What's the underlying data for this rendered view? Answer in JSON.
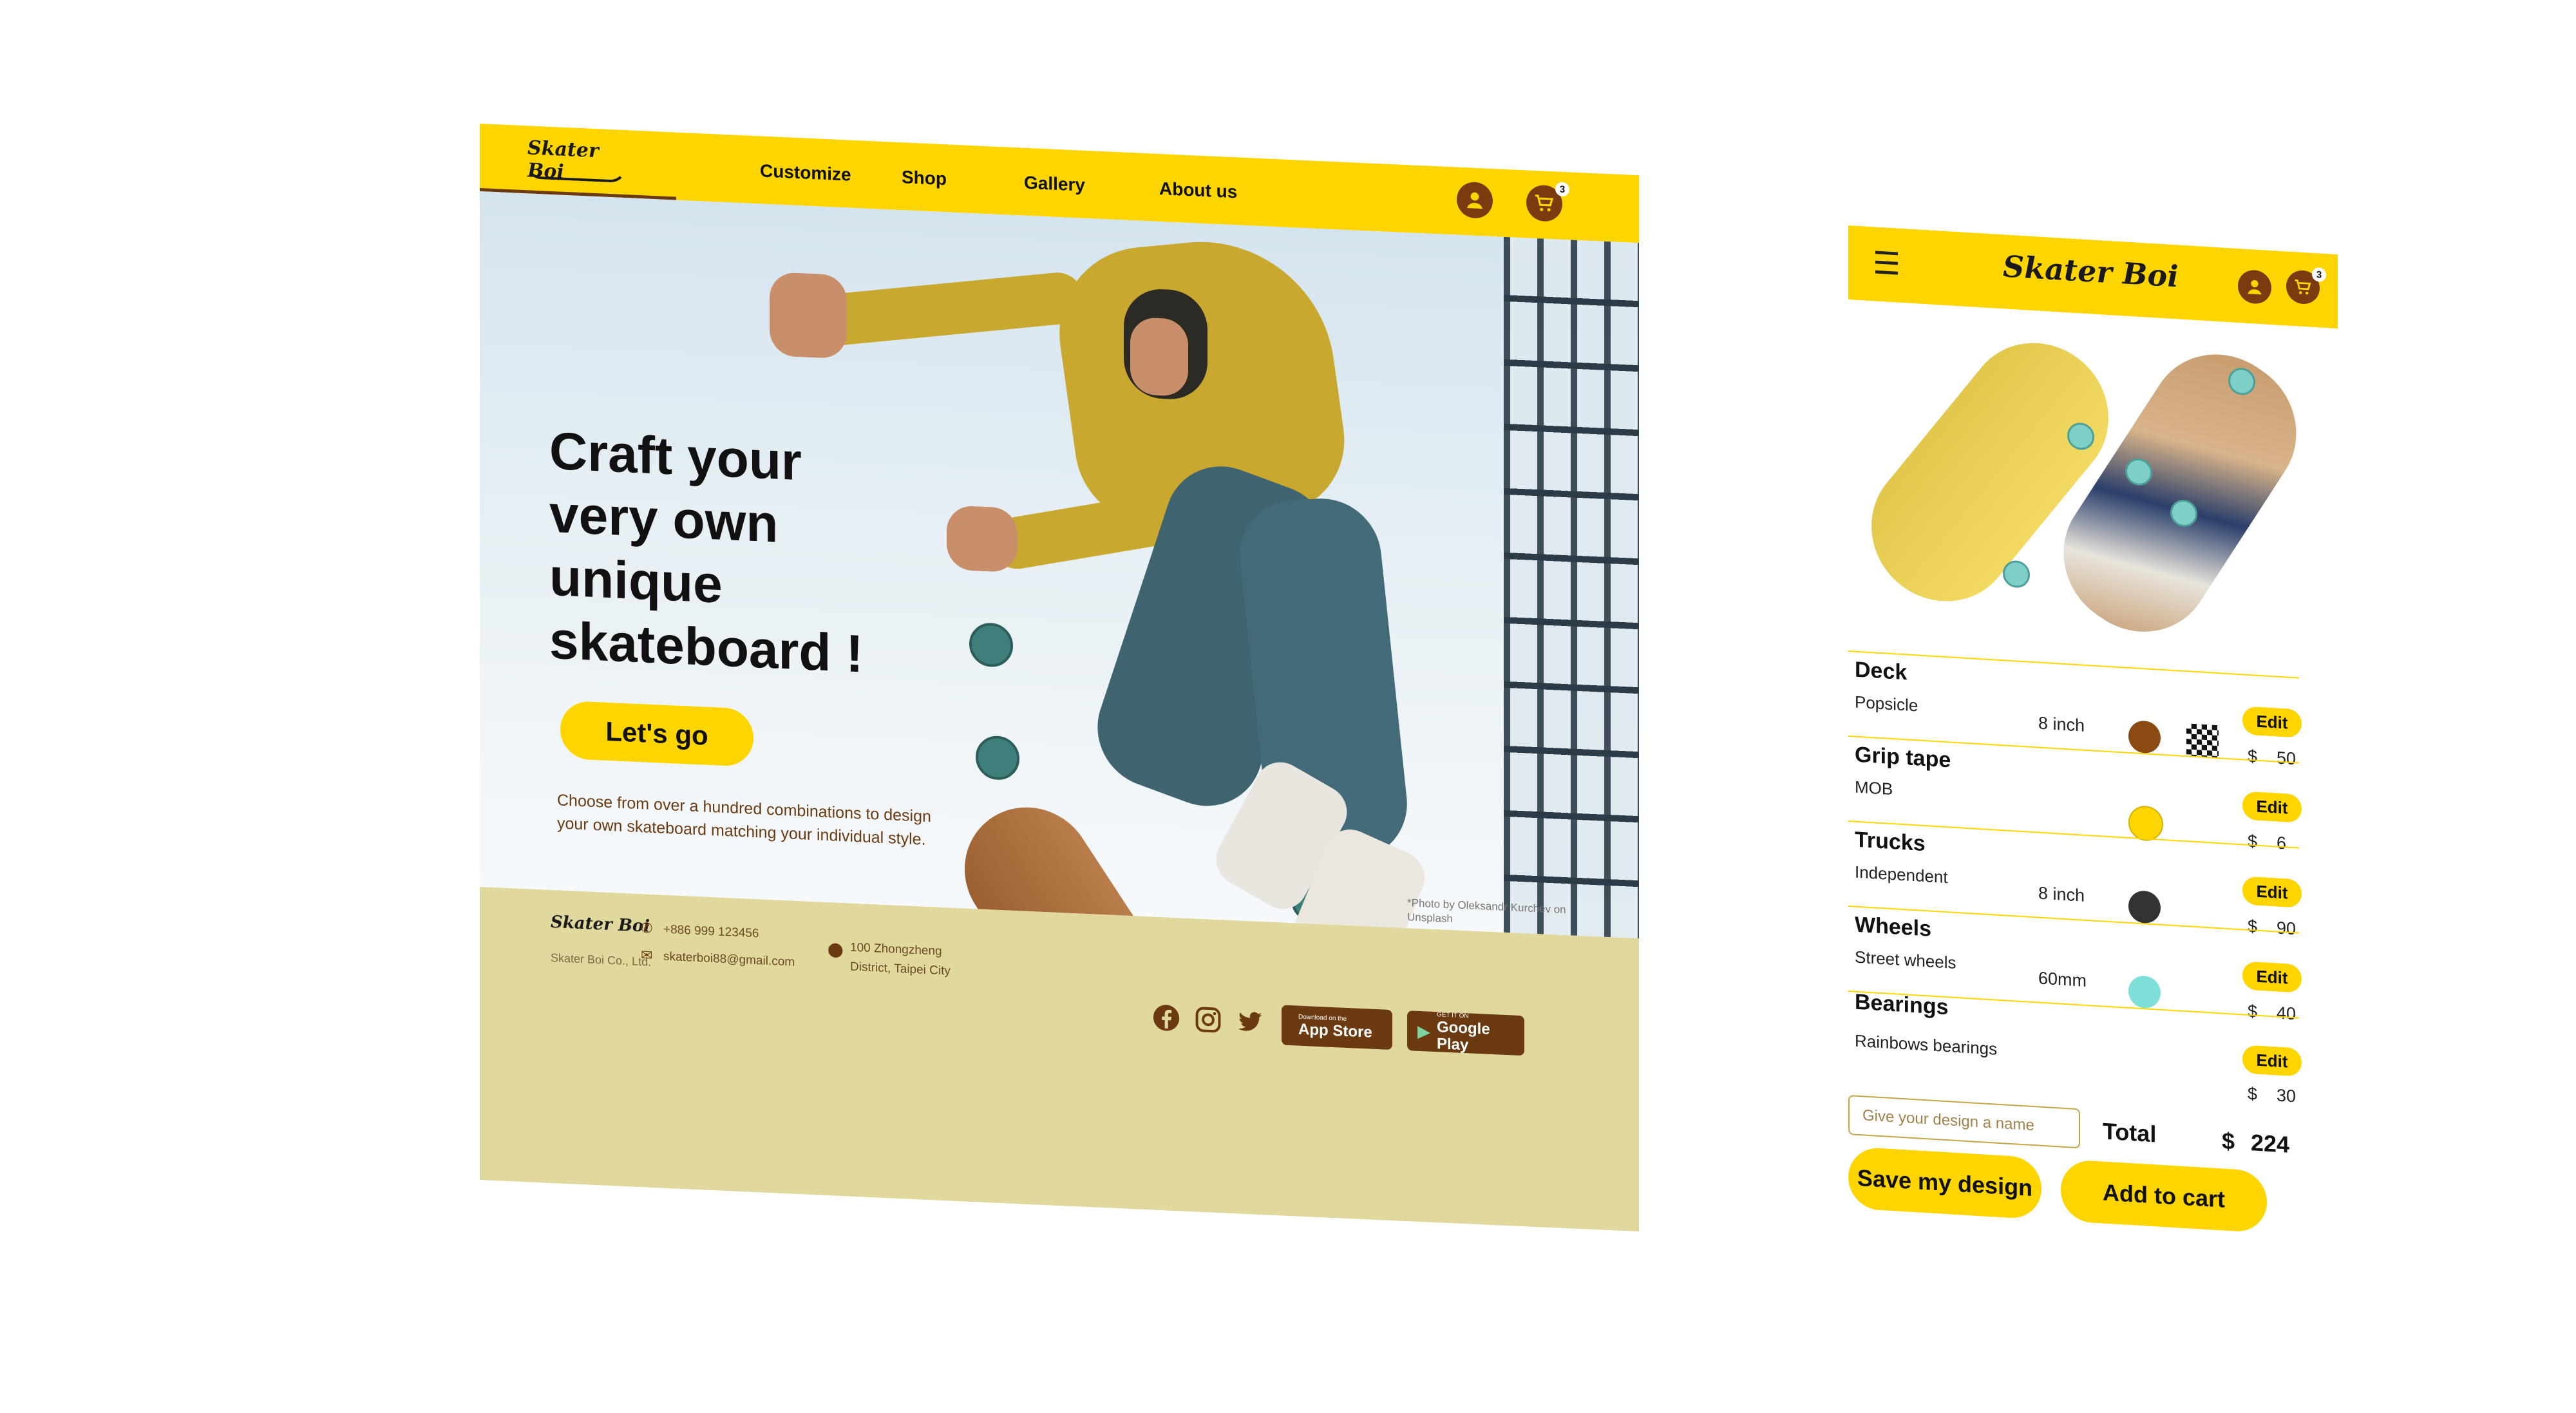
{
  "colors": {
    "brand_yellow": "#FFD500",
    "brand_brown": "#7A3B0E",
    "footer_bg": "#E1D89D"
  },
  "desktop": {
    "logo": "Skater Boi",
    "nav": [
      "Customize",
      "Shop",
      "Gallery",
      "About us"
    ],
    "icons": {
      "account": "user-icon",
      "cart": "cart-icon"
    },
    "cart_count": "3",
    "hero": {
      "title_lines": [
        "Craft your",
        "very own",
        "unique",
        "skateboard !"
      ],
      "cta": "Let's go",
      "subtitle": "Choose from over a hundred combinations to design your own skateboard matching your individual style."
    },
    "photo_credit": "*Photo by Oleksandr Kurchev on Unsplash",
    "footer": {
      "logo": "Skater Boi",
      "company": "Skater Boi Co., Ltd.",
      "phone": "+886 999 123456",
      "email": "skaterboi88@gmail.com",
      "address_line1": "100 Zhongzheng",
      "address_line2": "District, Taipei City",
      "social": [
        "facebook-icon",
        "instagram-icon",
        "twitter-icon"
      ],
      "app_store_small": "Download on the",
      "app_store_big": "App Store",
      "google_play_small": "GET IT ON",
      "google_play_big": "Google Play"
    }
  },
  "mobile": {
    "logo": "Skater Boi",
    "cart_count": "3",
    "edit_label": "Edit",
    "currency": "$",
    "components": [
      {
        "category": "Deck",
        "name": "Popsicle",
        "size": "8 inch",
        "colors": [
          "#8B4A12",
          "checker"
        ],
        "price": "50"
      },
      {
        "category": "Grip tape",
        "name": "MOB",
        "size": "",
        "colors": [
          "#FFD500"
        ],
        "price": "6"
      },
      {
        "category": "Trucks",
        "name": "Independent",
        "size": "8 inch",
        "colors": [
          "#333333"
        ],
        "price": "90"
      },
      {
        "category": "Wheels",
        "name": "Street wheels",
        "size": "60mm",
        "colors": [
          "#7FE0DA"
        ],
        "price": "40"
      },
      {
        "category": "Bearings",
        "name": "Rainbows bearings",
        "size": "",
        "colors": [],
        "price": "30"
      }
    ],
    "name_placeholder": "Give your design a name",
    "total_label": "Total",
    "total_value": "224",
    "save_button": "Save my design",
    "cart_button": "Add to cart"
  }
}
